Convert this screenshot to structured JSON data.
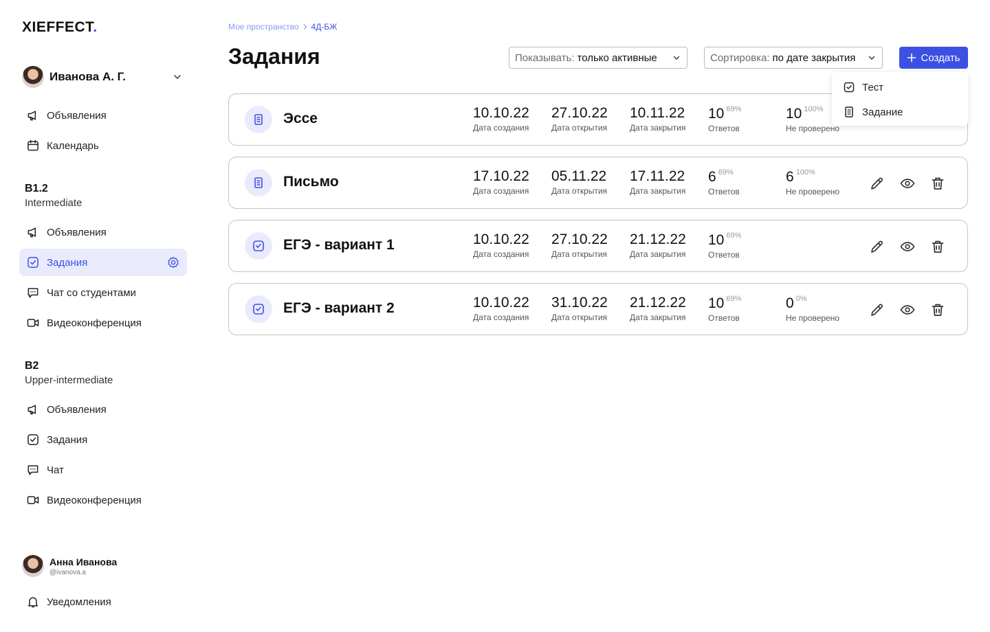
{
  "logo": {
    "text": "XIEFFECT",
    "dot": "."
  },
  "profile": {
    "name": "Иванова А. Г."
  },
  "nav_top": [
    {
      "label": "Объявления",
      "icon": "megaphone-icon"
    },
    {
      "label": "Календарь",
      "icon": "calendar-icon"
    }
  ],
  "groups": [
    {
      "title": "B1.2",
      "subtitle": "Intermediate",
      "items": [
        {
          "label": "Объявления",
          "icon": "megaphone-icon",
          "active": false
        },
        {
          "label": "Задания",
          "icon": "task-icon",
          "active": true
        },
        {
          "label": "Чат со студентами",
          "icon": "chat-icon",
          "active": false
        },
        {
          "label": "Видеоконференция",
          "icon": "video-icon",
          "active": false
        }
      ]
    },
    {
      "title": "B2",
      "subtitle": "Upper-intermediate",
      "items": [
        {
          "label": "Объявления",
          "icon": "megaphone-icon",
          "active": false
        },
        {
          "label": "Задания",
          "icon": "task-icon",
          "active": false
        },
        {
          "label": "Чат",
          "icon": "chat-icon",
          "active": false
        },
        {
          "label": "Видеоконференция",
          "icon": "video-icon",
          "active": false
        }
      ]
    }
  ],
  "user": {
    "name": "Анна Иванова",
    "handle": "@ivanova.a"
  },
  "notifications": {
    "label": "Уведомления"
  },
  "breadcrumb": {
    "root": "Мое пространство",
    "current": "4Д-БЖ"
  },
  "page_title": "Задания",
  "filter": {
    "label": "Показывать:",
    "value": "только активные"
  },
  "sort": {
    "label": "Сортировка:",
    "value": "по дате закрытия"
  },
  "create_button": {
    "label": "Создать"
  },
  "create_menu": [
    {
      "label": "Тест",
      "icon": "test-icon"
    },
    {
      "label": "Задание",
      "icon": "document-icon"
    }
  ],
  "captions": {
    "created": "Дата создания",
    "opened": "Дата открытия",
    "closed": "Дата закрытия",
    "answers": "Ответов",
    "unchecked": "Не проверено"
  },
  "assignments": [
    {
      "name": "Эссе",
      "type": "document-icon",
      "created": "10.10.22",
      "opened": "27.10.22",
      "closed": "10.11.22",
      "answers": "10",
      "answers_pct": "69%",
      "unchecked": "10",
      "unchecked_pct": "100%"
    },
    {
      "name": "Письмо",
      "type": "document-icon",
      "created": "17.10.22",
      "opened": "05.11.22",
      "closed": "17.11.22",
      "answers": "6",
      "answers_pct": "69%",
      "unchecked": "6",
      "unchecked_pct": "100%"
    },
    {
      "name": "ЕГЭ - вариант 1",
      "type": "test-icon",
      "created": "10.10.22",
      "opened": "27.10.22",
      "closed": "21.12.22",
      "answers": "10",
      "answers_pct": "69%",
      "unchecked": null,
      "unchecked_pct": null
    },
    {
      "name": "ЕГЭ - вариант 2",
      "type": "test-icon",
      "created": "10.10.22",
      "opened": "31.10.22",
      "closed": "21.12.22",
      "answers": "10",
      "answers_pct": "69%",
      "unchecked": "0",
      "unchecked_pct": "0%"
    }
  ],
  "colors": {
    "accent": "#3c51e3",
    "accent_light": "#e9ebfc",
    "border": "#c4c4c4"
  }
}
